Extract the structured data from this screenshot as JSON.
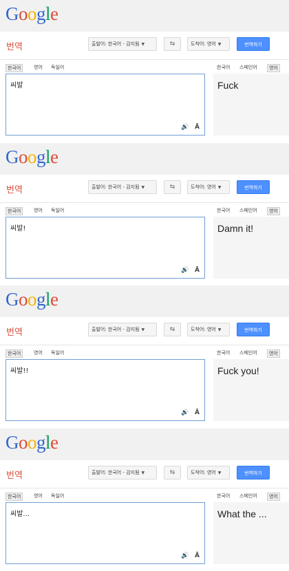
{
  "logo_letters": [
    "G",
    "o",
    "o",
    "g",
    "l",
    "e"
  ],
  "toolbar": {
    "title": "번역",
    "source_dropdown": "출발어: 한국어 - 감지됨",
    "swap_icon": "⇆",
    "target_dropdown": "도착어: 영어",
    "translate_button": "번역하기"
  },
  "source_langs": [
    "한국어",
    "영어",
    "독일어"
  ],
  "target_langs": [
    "한국어",
    "스페인어",
    "영어"
  ],
  "icons": {
    "speaker": "🔊",
    "keyboard": "Ā"
  },
  "panels": [
    {
      "input": "씨발",
      "output": "Fuck"
    },
    {
      "input": "씨발!",
      "output": "Damn it!"
    },
    {
      "input": "씨발!!",
      "output": "Fuck you!"
    },
    {
      "input": "씨발...",
      "output": "What the ..."
    }
  ]
}
